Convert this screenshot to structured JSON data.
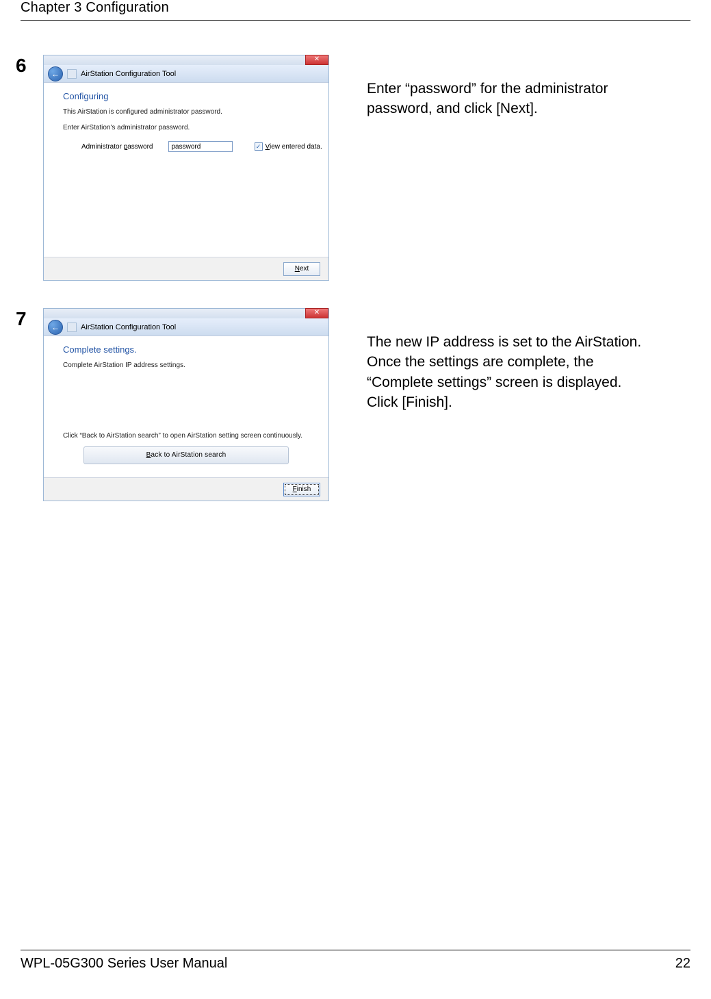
{
  "page": {
    "chapter_line": "Chapter 3  Configuration",
    "footer_text": "WPL-05G300 Series User Manual",
    "page_number": "22"
  },
  "steps": [
    {
      "num": "6",
      "window": {
        "close_glyph": "✕",
        "back_glyph": "←",
        "title": "AirStation Configuration Tool",
        "subtitle": "Configuring",
        "line1": "This AirStation is configured administrator password.",
        "line2": "Enter AirStation's administrator password.",
        "field_label_prefix": "Administrator ",
        "field_label_u": "p",
        "field_label_rest": "assword",
        "field_value": "password",
        "checkbox_label_u": "V",
        "checkbox_label_rest": "iew entered data.",
        "next_btn_u": "N",
        "next_btn_rest": "ext"
      },
      "instruction": "Enter “password” for the administrator password, and click [Next]."
    },
    {
      "num": "7",
      "window": {
        "close_glyph": "✕",
        "back_glyph": "←",
        "title": "AirStation Configuration Tool",
        "subtitle": "Complete settings.",
        "line1": "Complete AirStation IP address settings.",
        "note": "Click “Back to AirStation search” to open AirStation setting screen continuously.",
        "big_btn_u": "B",
        "big_btn_rest": "ack to AirStation search",
        "finish_btn_u": "F",
        "finish_btn_rest": "inish"
      },
      "instruction": "The new IP address is set to the AirStation. Once the settings are complete, the “Complete settings” screen is displayed. Click [Finish]."
    }
  ]
}
